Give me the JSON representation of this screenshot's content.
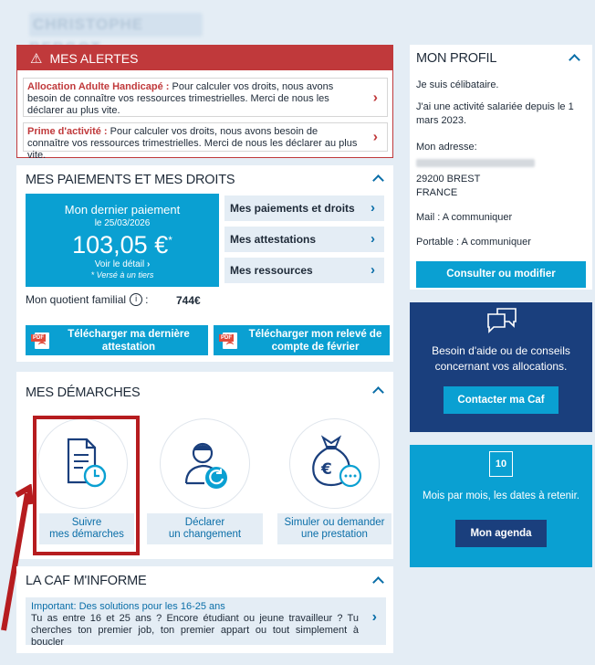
{
  "user": {
    "name": "CHRISTOPHE BERGOT"
  },
  "alerts": {
    "title": "MES ALERTES",
    "items": [
      {
        "label": "Allocation Adulte Handicapé :",
        "text": " Pour calculer vos droits, nous avons besoin de connaître vos ressources trimestrielles. Merci de nous les déclarer au plus vite."
      },
      {
        "label": "Prime d'activité :",
        "text": " Pour calculer vos droits, nous avons besoin de connaître vos ressources trimestrielles. Merci de nous les déclarer au plus vite."
      }
    ]
  },
  "payments": {
    "title": "MES PAIEMENTS ET MES DROITS",
    "last_payment_label": "Mon dernier paiement",
    "date": "le 25/03/2026",
    "amount": "103,05 €",
    "amount_mark": "*",
    "detail_link": "Voir le détail",
    "third_party_note": "* Versé à un tiers",
    "links": [
      "Mes paiements et droits",
      "Mes attestations",
      "Mes ressources"
    ],
    "quotient_label": "Mon quotient familial",
    "quotient_value": "744€",
    "download_attestation": "Télécharger ma dernière attestation",
    "download_statement": "Télécharger mon relevé de compte de février"
  },
  "demarches": {
    "title": "MES DÉMARCHES",
    "items": [
      {
        "line1": "Suivre",
        "line2": "mes démarches"
      },
      {
        "line1": "Déclarer",
        "line2": "un changement"
      },
      {
        "line1": "Simuler ou demander",
        "line2": "une prestation"
      }
    ]
  },
  "caf_info": {
    "title": "LA CAF M'INFORME",
    "news_title": "Important: Des solutions pour les 16-25 ans",
    "news_text": "Tu as entre 16 et 25 ans ? Encore étudiant ou jeune travailleur ? Tu cherches ton premier job, ton premier appart ou tout simplement à boucler"
  },
  "profile": {
    "title": "MON PROFIL",
    "status": "Je suis célibataire.",
    "activity": "J'ai une activité salariée depuis le 1 mars 2023.",
    "address_label": "Mon adresse:",
    "postal_city": "29200 BREST",
    "country": "FRANCE",
    "mail": "Mail : A communiquer",
    "phone": "Portable : A communiquer",
    "edit_button": "Consulter ou modifier"
  },
  "help": {
    "text": "Besoin d'aide ou de conseils concernant vos allocations.",
    "button": "Contacter ma Caf"
  },
  "agenda": {
    "calendar_day": "10",
    "text": "Mois par mois, les dates à retenir.",
    "button": "Mon agenda"
  },
  "colors": {
    "alert_red": "#c0393b",
    "caf_blue": "#0aa0d2",
    "navy": "#1a3f7d",
    "link_blue": "#0a6ea8",
    "highlight_red": "#b61c1f"
  }
}
